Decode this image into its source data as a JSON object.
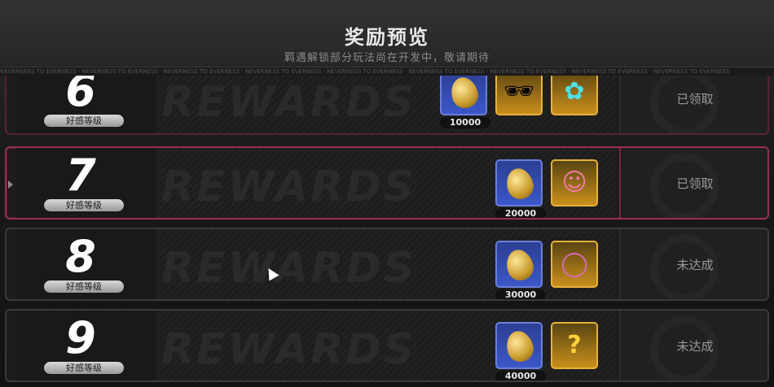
{
  "header": {
    "title": "奖励预览",
    "subtitle": "羁遇解锁部分玩法尚在开发中，敬请期待"
  },
  "marquee_text": "NEVERNESS TO EVERNESS · NEVERNESS TO EVERNESS · NEVERNESS TO EVERNESS · NEVERNESS TO EVERNESS · NEVERNESS TO EVERNESS · NEVERNESS TO EVERNESS · NEVERNESS TO EVERNESS · NEVERNESS TO EVERNESS · NEVERNESS TO EVERNESS",
  "level_label": "好感等级",
  "rewards_watermark": "REWARDS",
  "rows": [
    {
      "level": "6",
      "status": "已领取",
      "items": [
        {
          "icon": "gold-egg-icon",
          "rarity": "blue",
          "count": "10000"
        },
        {
          "icon": "pixel-sunglasses-icon",
          "rarity": "gold",
          "glyph": "🕶"
        },
        {
          "icon": "cyan-flower-creature-icon",
          "rarity": "gold",
          "glyph": "✿"
        }
      ]
    },
    {
      "level": "7",
      "status": "已领取",
      "selected": true,
      "items": [
        {
          "icon": "gold-egg-icon",
          "rarity": "blue",
          "count": "20000"
        },
        {
          "icon": "pink-hair-character-icon",
          "rarity": "gold",
          "glyph": "☺"
        }
      ]
    },
    {
      "level": "8",
      "status": "未达成",
      "items": [
        {
          "icon": "gold-egg-icon",
          "rarity": "blue",
          "count": "30000"
        },
        {
          "icon": "cat-ear-frame-icon",
          "rarity": "gold",
          "glyph": "◯"
        }
      ]
    },
    {
      "level": "9",
      "status": "未达成",
      "items": [
        {
          "icon": "gold-egg-icon",
          "rarity": "blue",
          "count": "40000"
        },
        {
          "icon": "mystery-box-icon",
          "rarity": "gold",
          "glyph": "?"
        }
      ]
    }
  ],
  "colors": {
    "selected_border": "#9a2d55",
    "blue_frame": "#3b57c8",
    "gold_frame": "#c98f1c"
  }
}
